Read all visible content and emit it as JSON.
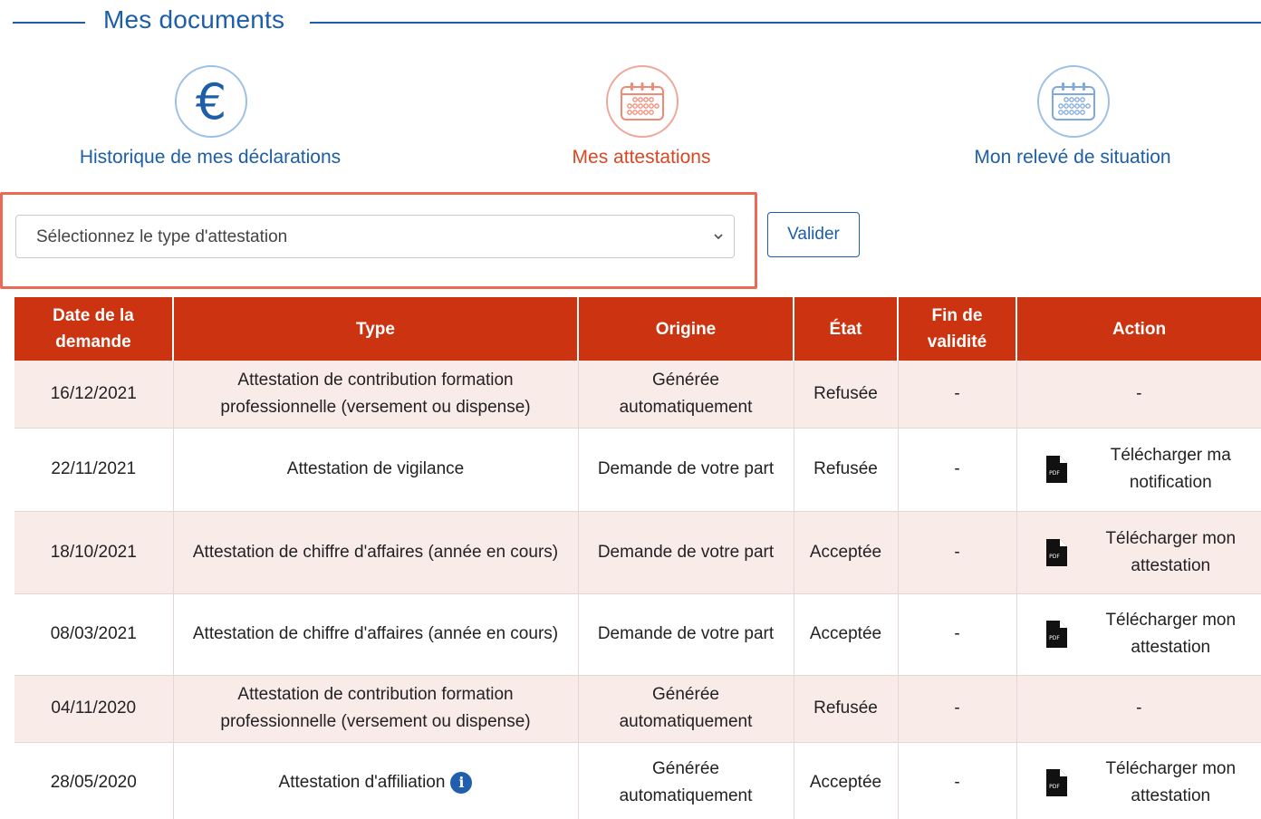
{
  "section": {
    "title": "Mes documents"
  },
  "tiles": [
    {
      "label": "Historique de mes déclarations",
      "icon": "euro-icon",
      "glyph": "€",
      "active": false
    },
    {
      "label": "Mes attestations",
      "icon": "calendar-icon",
      "active": true
    },
    {
      "label": "Mon relevé de situation",
      "icon": "calendar-icon",
      "active": false
    }
  ],
  "form": {
    "select_placeholder": "Sélectionnez le type d'attestation",
    "submit_label": "Valider"
  },
  "colors": {
    "brand_blue": "#1c5ea8",
    "header_red": "#cc3311",
    "highlight_frame": "#ec6a55",
    "row_tint": "#f9ebe8"
  },
  "table": {
    "headers": [
      "Date de la demande",
      "Type",
      "Origine",
      "État",
      "Fin de validité",
      "Action"
    ],
    "rows": [
      {
        "date": "16/12/2021",
        "type": "Attestation de contribution formation professionnelle (versement ou dispense)",
        "origin": "Générée automatiquement",
        "state": "Refusée",
        "end": "-",
        "action": "-",
        "has_pdf": false,
        "info": false
      },
      {
        "date": "22/11/2021",
        "type": "Attestation de vigilance",
        "origin": "Demande de votre part",
        "state": "Refusée",
        "end": "-",
        "action": "Télécharger ma notification",
        "has_pdf": true,
        "info": false
      },
      {
        "date": "18/10/2021",
        "type": "Attestation de chiffre d'affaires (année en cours)",
        "origin": "Demande de votre part",
        "state": "Acceptée",
        "end": "-",
        "action": "Télécharger mon attestation",
        "has_pdf": true,
        "info": false
      },
      {
        "date": "08/03/2021",
        "type": "Attestation de chiffre d'affaires (année en cours)",
        "origin": "Demande de votre part",
        "state": "Acceptée",
        "end": "-",
        "action": "Télécharger mon attestation",
        "has_pdf": true,
        "info": false
      },
      {
        "date": "04/11/2020",
        "type": "Attestation de contribution formation professionnelle (versement ou dispense)",
        "origin": "Générée automatiquement",
        "state": "Refusée",
        "end": "-",
        "action": "-",
        "has_pdf": false,
        "info": false
      },
      {
        "date": "28/05/2020",
        "type": "Attestation d'affiliation",
        "origin": "Générée automatiquement",
        "state": "Acceptée",
        "end": "-",
        "action": "Télécharger mon attestation",
        "has_pdf": true,
        "info": true,
        "info_glyph": "i"
      }
    ]
  }
}
